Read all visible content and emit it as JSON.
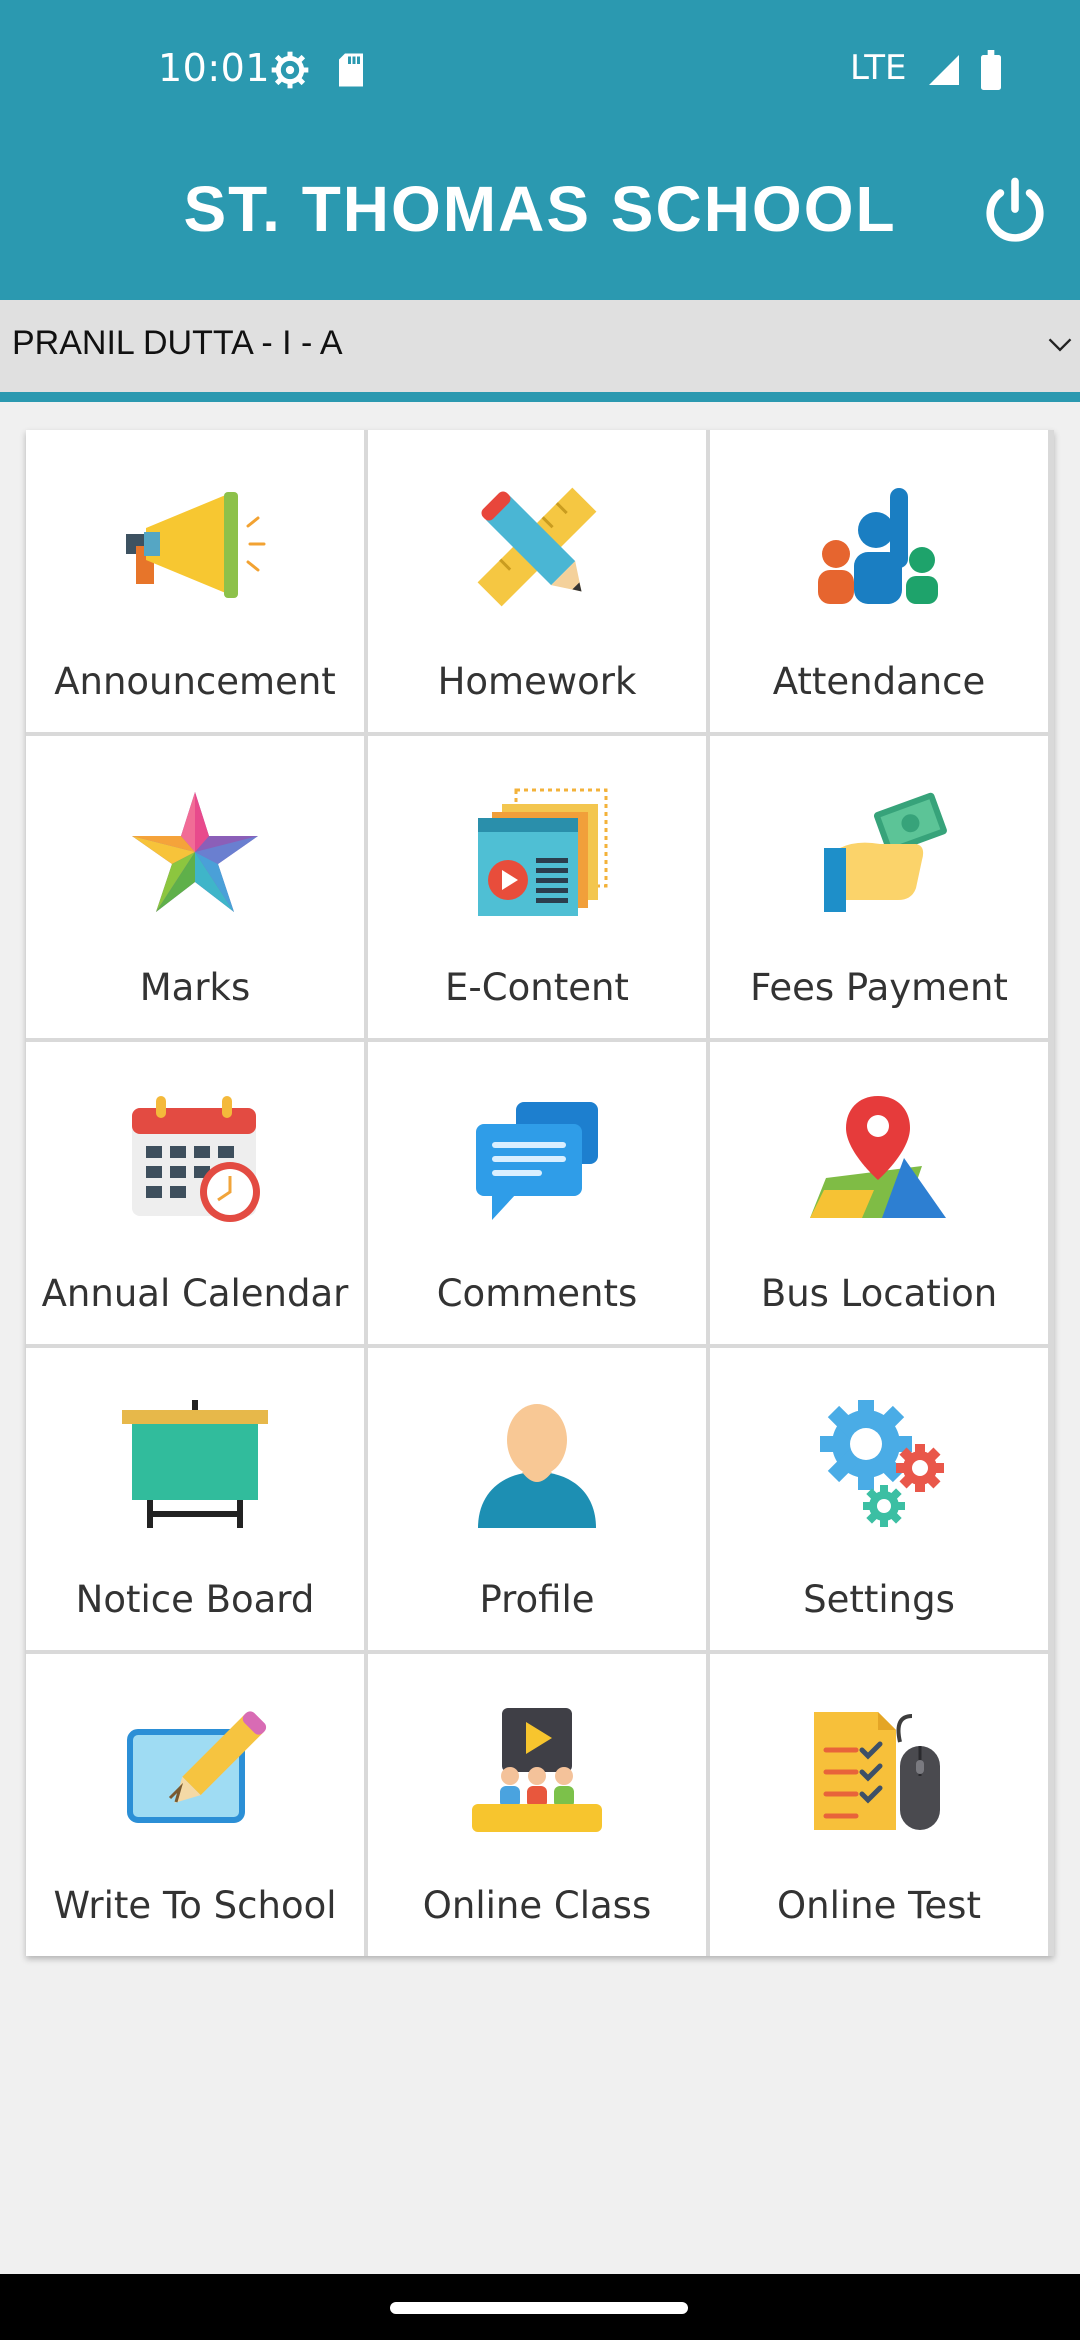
{
  "status_bar": {
    "time": "10:01",
    "network": "LTE",
    "icons": [
      "gear-icon",
      "sd-card-icon",
      "signal-icon",
      "battery-icon"
    ]
  },
  "app_bar": {
    "title": "ST. THOMAS SCHOOL",
    "power_icon": "power-icon",
    "color": "#2b99b0"
  },
  "student_selector": {
    "value": "PRANIL DUTTA - I - A"
  },
  "menu": [
    {
      "label": "Announcement",
      "icon": "megaphone-icon"
    },
    {
      "label": "Homework",
      "icon": "pencil-ruler-icon"
    },
    {
      "label": "Attendance",
      "icon": "raised-hand-people-icon"
    },
    {
      "label": "Marks",
      "icon": "star-icon"
    },
    {
      "label": "E-Content",
      "icon": "video-content-icon"
    },
    {
      "label": "Fees Payment",
      "icon": "hand-money-icon"
    },
    {
      "label": "Annual Calendar",
      "icon": "calendar-clock-icon"
    },
    {
      "label": "Comments",
      "icon": "chat-bubbles-icon"
    },
    {
      "label": "Bus Location",
      "icon": "map-pin-icon"
    },
    {
      "label": "Notice Board",
      "icon": "notice-board-icon"
    },
    {
      "label": "Profile",
      "icon": "person-icon"
    },
    {
      "label": "Settings",
      "icon": "gears-icon"
    },
    {
      "label": "Write To School",
      "icon": "write-pencil-icon"
    },
    {
      "label": "Online Class",
      "icon": "online-class-icon"
    },
    {
      "label": "Online Test",
      "icon": "checklist-mouse-icon"
    }
  ]
}
